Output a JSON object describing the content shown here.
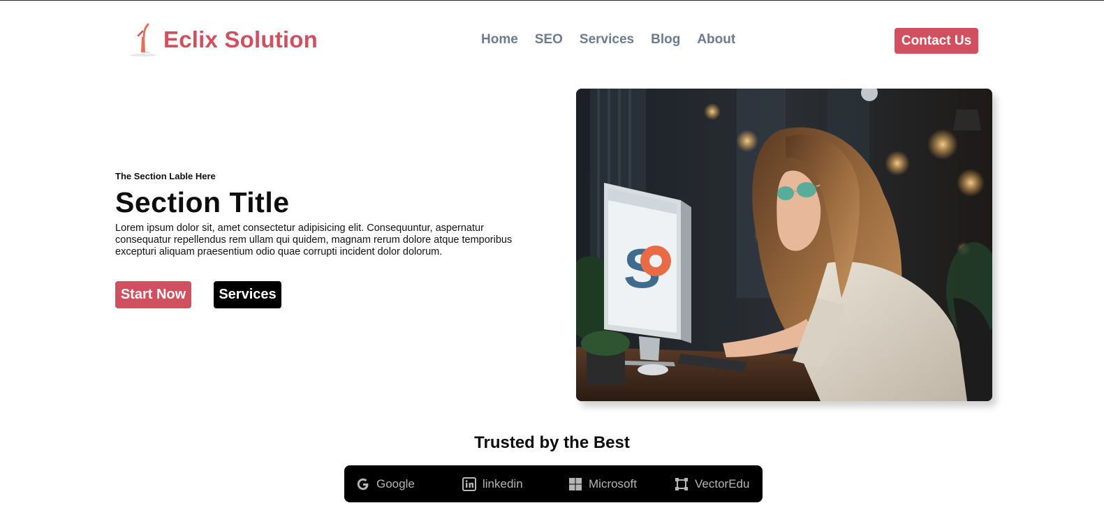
{
  "header": {
    "brand_name": "Eclix Solution",
    "nav": [
      "Home",
      "SEO",
      "Services",
      "Blog",
      "About"
    ],
    "contact_label": "Contact Us"
  },
  "hero": {
    "label": "The Section Lable Here",
    "title": "Section Title",
    "body": "Lorem ipsum dolor sit, amet consectetur adipisicing elit. Consequuntur, aspernatur consequatur repellendus rem ullam qui quidem, magnam rerum dolore atque temporibus excepturi aliquam praesentium odio quae corrupti incident dolor dolorum.",
    "start_label": "Start Now",
    "services_label": "Services",
    "monitor_text": "SO"
  },
  "trusted": {
    "title": "Trusted by the Best",
    "brands": [
      {
        "name": "Google",
        "icon": "google-icon"
      },
      {
        "name": "linkedin",
        "icon": "linkedin-icon"
      },
      {
        "name": "Microsoft",
        "icon": "microsoft-icon"
      },
      {
        "name": "VectorEdu",
        "icon": "vector-icon"
      }
    ]
  },
  "colors": {
    "accent": "#d1505f",
    "nav_text": "#6d7b91",
    "dark": "#000000"
  }
}
